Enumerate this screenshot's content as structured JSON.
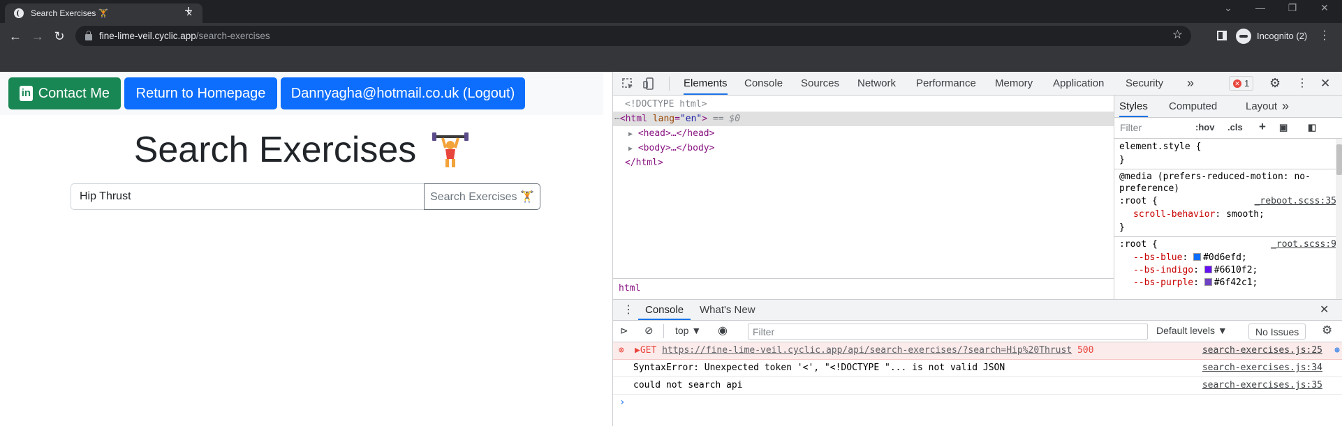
{
  "browser": {
    "tab_title": "Search Exercises 🏋",
    "new_tab": "+",
    "url_host": "fine-lime-veil.cyclic.app",
    "url_path": "/search-exercises",
    "incognito_label": "Incognito (2)"
  },
  "page": {
    "buttons": {
      "contact": "Contact Me",
      "contact_icon": "in",
      "homepage": "Return to Homepage",
      "logout": "Dannyagha@hotmail.co.uk (Logout)"
    },
    "heading": "Search Exercises",
    "search_value": "Hip Thrust",
    "search_button": "Search Exercises 🏋"
  },
  "devtools": {
    "tabs": [
      "Elements",
      "Console",
      "Sources",
      "Network",
      "Performance",
      "Memory",
      "Application",
      "Security"
    ],
    "more": "»",
    "error_count": "1",
    "elements": {
      "doctype": "<!DOCTYPE html>",
      "html_open_tag": "<html",
      "html_attr": "lang",
      "html_attr_value": "\"en\"",
      "html_close_bracket": ">",
      "selected_marker": "== $0",
      "head": "<head>…</head>",
      "body": "<body>…</body>",
      "html_close": "</html>",
      "breadcrumb": "html"
    },
    "styles": {
      "tabs": [
        "Styles",
        "Computed",
        "Layout"
      ],
      "filter": "Filter",
      "hov": ":hov",
      "cls": ".cls",
      "plus": "+",
      "element_style": "element.style {",
      "close_brace": "}",
      "media_line1": "@media (prefers-reduced-motion: no-",
      "media_line2": "preference)",
      "root_selector": ":root {",
      "reboot_src": "_reboot.scss:35",
      "scroll_prop": "scroll-behavior",
      "scroll_val": "smooth;",
      "root_src": "_root.scss:9",
      "vars": [
        {
          "name": "--bs-blue",
          "value": "#0d6efd;",
          "color": "#0d6efd"
        },
        {
          "name": "--bs-indigo",
          "value": "#6610f2;",
          "color": "#6610f2"
        },
        {
          "name": "--bs-purple",
          "value": "#6f42c1;",
          "color": "#6f42c1"
        }
      ]
    },
    "drawer": {
      "tabs": [
        "Console",
        "What's New"
      ],
      "context": "top ▼",
      "filter_placeholder": "Filter",
      "levels": "Default levels ▼",
      "issues": "No Issues",
      "messages": [
        {
          "text_prefix": "▶GET ",
          "url": "https://fine-lime-veil.cyclic.app/api/search-exercises/?search=Hip%20Thrust",
          "status": "500",
          "source": "search-exercises.js:25"
        },
        {
          "text": "SyntaxError: Unexpected token '<', \"<!DOCTYPE \"... is not valid JSON",
          "source": "search-exercises.js:34"
        },
        {
          "text": "could not search api",
          "source": "search-exercises.js:35"
        }
      ],
      "prompt": "›"
    }
  }
}
